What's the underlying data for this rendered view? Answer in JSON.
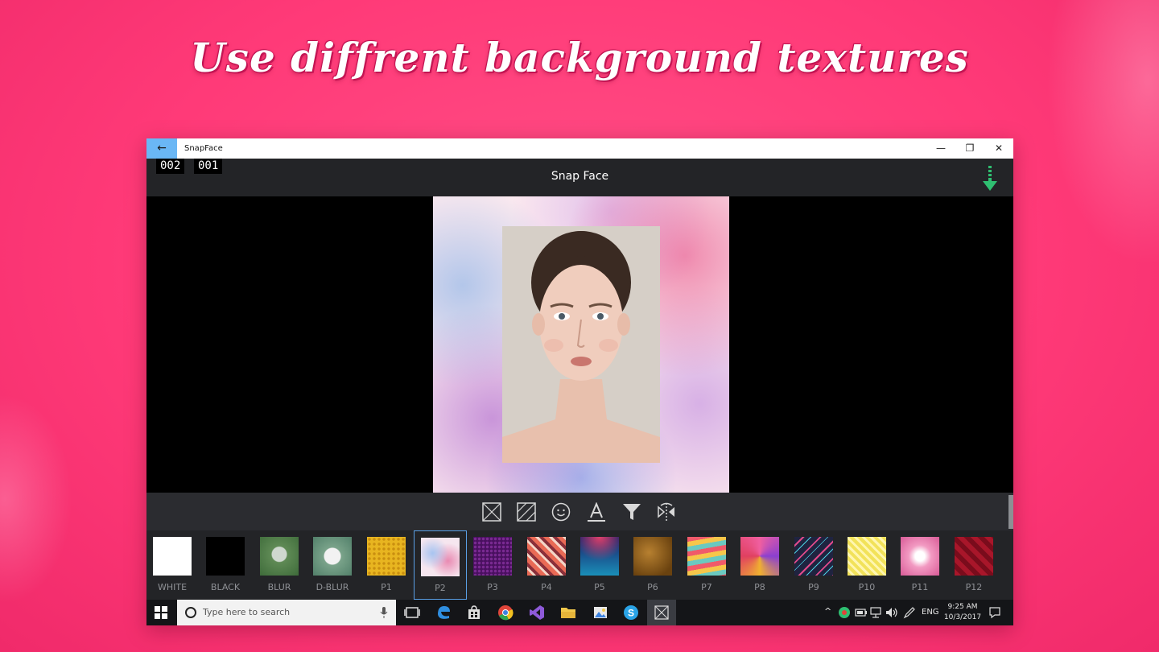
{
  "headline": "Use diffrent background textures",
  "window": {
    "title": "SnapFace",
    "back_icon": "back-arrow-icon",
    "minimize": "—",
    "restore": "❐",
    "close": "✕"
  },
  "header": {
    "counter_a": "002",
    "counter_b": "001",
    "title": "Snap Face",
    "download_icon": "download-arrow-icon",
    "accent": "#2fbf71"
  },
  "toolbar": {
    "tools": [
      "frame-icon",
      "texture-icon",
      "emoji-icon",
      "text-icon",
      "filter-icon",
      "flip-icon"
    ]
  },
  "textures": [
    {
      "label": "WHITE",
      "swatch": "#ffffff"
    },
    {
      "label": "BLACK",
      "swatch": "#000000"
    },
    {
      "label": "BLUR",
      "swatch": "#5f8a55"
    },
    {
      "label": "D-BLUR",
      "swatch": "#7aa38a"
    },
    {
      "label": "P1",
      "swatch": "#e8b520"
    },
    {
      "label": "P2",
      "swatch": "#f3c6da",
      "selected": true
    },
    {
      "label": "P3",
      "swatch": "#5a1a6e"
    },
    {
      "label": "P4",
      "swatch": "#d9634f"
    },
    {
      "label": "P5",
      "swatch": "#1b3a8f"
    },
    {
      "label": "P6",
      "swatch": "#8a5a1e"
    },
    {
      "label": "P7",
      "swatch": "#f5a44a"
    },
    {
      "label": "P8",
      "swatch": "#d84ba0"
    },
    {
      "label": "P9",
      "swatch": "#1f2340"
    },
    {
      "label": "P10",
      "swatch": "#f2e25a"
    },
    {
      "label": "P11",
      "swatch": "#f29ac2"
    },
    {
      "label": "P12",
      "swatch": "#a8162a"
    }
  ],
  "taskbar": {
    "start_icon": "windows-start-icon",
    "search_placeholder": "Type here to search",
    "lang": "ENG",
    "time": "9:25 AM",
    "date": "10/3/2017"
  }
}
